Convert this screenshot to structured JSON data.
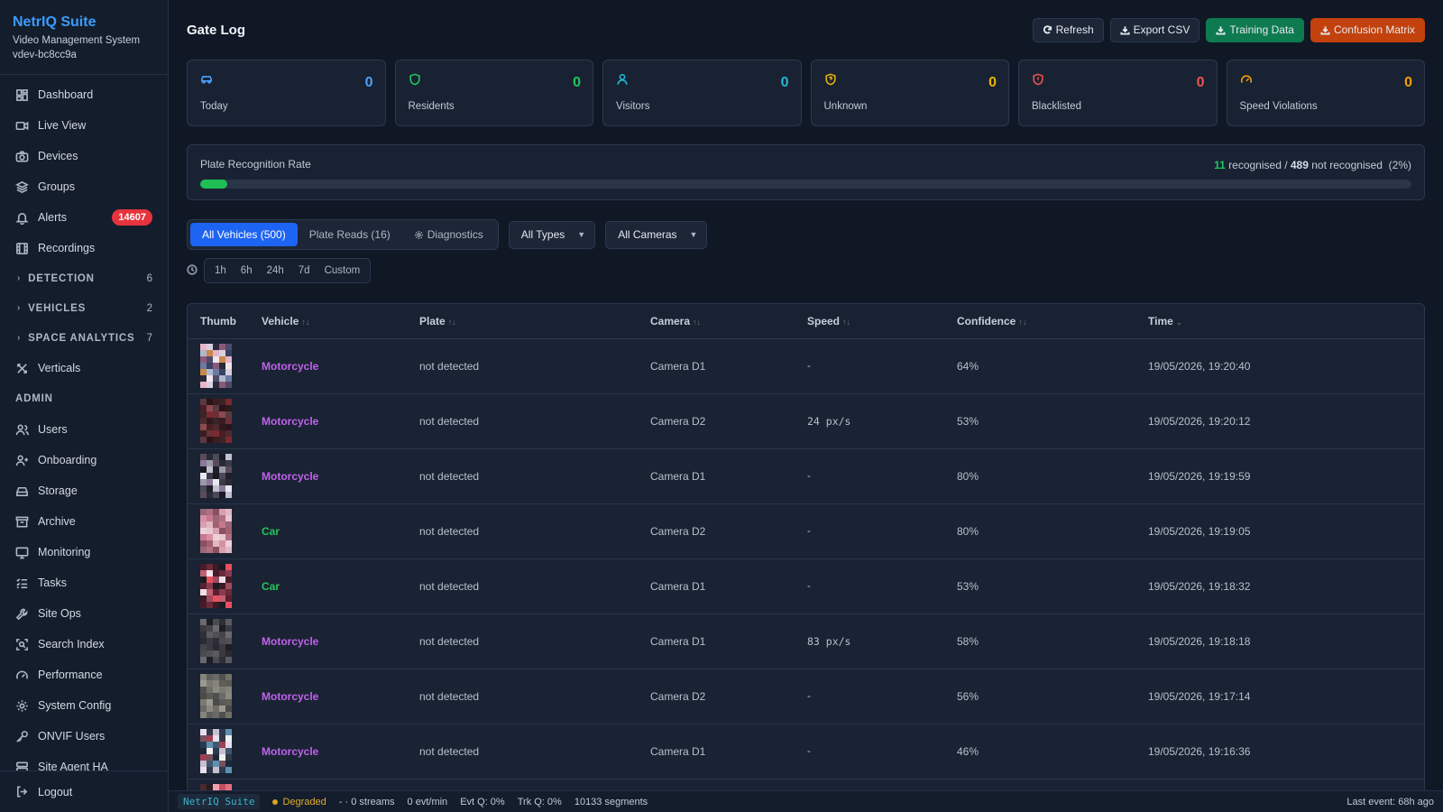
{
  "brand": {
    "title": "NetrIQ Suite",
    "subtitle": "Video Management System",
    "version": "vdev-bc8cc9a"
  },
  "sidebar": {
    "items": [
      {
        "label": "Dashboard",
        "icon": "dashboard-icon"
      },
      {
        "label": "Live View",
        "icon": "video-icon"
      },
      {
        "label": "Devices",
        "icon": "camera-icon"
      },
      {
        "label": "Groups",
        "icon": "layers-icon"
      },
      {
        "label": "Alerts",
        "icon": "bell-icon",
        "badge": "14607"
      },
      {
        "label": "Recordings",
        "icon": "film-icon"
      }
    ],
    "sections": [
      {
        "label": "DETECTION",
        "count": "6"
      },
      {
        "label": "VEHICLES",
        "count": "2"
      },
      {
        "label": "SPACE ANALYTICS",
        "count": "7"
      }
    ],
    "verticals": "Verticals",
    "admin_label": "ADMIN",
    "admin_items": [
      {
        "label": "Users",
        "icon": "users-icon"
      },
      {
        "label": "Onboarding",
        "icon": "user-plus-icon"
      },
      {
        "label": "Storage",
        "icon": "storage-icon"
      },
      {
        "label": "Archive",
        "icon": "archive-icon"
      },
      {
        "label": "Monitoring",
        "icon": "monitor-icon"
      },
      {
        "label": "Tasks",
        "icon": "tasks-icon"
      },
      {
        "label": "Site Ops",
        "icon": "wrench-icon"
      },
      {
        "label": "Search Index",
        "icon": "scan-icon"
      },
      {
        "label": "Performance",
        "icon": "gauge-icon"
      },
      {
        "label": "System Config",
        "icon": "gear-icon"
      },
      {
        "label": "ONVIF Users",
        "icon": "key-icon"
      },
      {
        "label": "Site Agent HA",
        "icon": "server-icon"
      }
    ],
    "logout": "Logout"
  },
  "header": {
    "title": "Gate Log",
    "buttons": {
      "refresh": "Refresh",
      "export": "Export CSV",
      "training": "Training Data",
      "confusion": "Confusion Matrix"
    }
  },
  "stats": [
    {
      "label": "Today",
      "value": "0",
      "color": "#4aa3ff",
      "icon": "car-icon"
    },
    {
      "label": "Residents",
      "value": "0",
      "color": "#22c55e",
      "icon": "shield-icon"
    },
    {
      "label": "Visitors",
      "value": "0",
      "color": "#22b8d6",
      "icon": "user-icon"
    },
    {
      "label": "Unknown",
      "value": "0",
      "color": "#eab308",
      "icon": "shield-question-icon"
    },
    {
      "label": "Blacklisted",
      "value": "0",
      "color": "#f05252",
      "icon": "shield-alert-icon"
    },
    {
      "label": "Speed Violations",
      "value": "0",
      "color": "#f59e0b",
      "icon": "gauge-icon"
    }
  ],
  "rate": {
    "label": "Plate Recognition Rate",
    "recognised": "11",
    "recognised_text": "recognised /",
    "not_recognised": "489",
    "not_recognised_text": "not recognised",
    "percent_text": "(2%)",
    "fill_fraction": 0.022
  },
  "filters": {
    "tabs": [
      "All Vehicles (500)",
      "Plate Reads (16)",
      "Diagnostics"
    ],
    "type_select": "All Types",
    "camera_select": "All Cameras",
    "time_ranges": [
      "1h",
      "6h",
      "24h",
      "7d",
      "Custom"
    ]
  },
  "table": {
    "columns": [
      "Thumb",
      "Vehicle",
      "Plate",
      "Camera",
      "Speed",
      "Confidence",
      "Time"
    ],
    "rows": [
      {
        "vehicle": "Motorcycle",
        "plate": "not detected",
        "camera": "Camera D1",
        "speed": "-",
        "confidence": "64%",
        "time": "19/05/2026, 19:20:40"
      },
      {
        "vehicle": "Motorcycle",
        "plate": "not detected",
        "camera": "Camera D2",
        "speed": "24 px/s",
        "confidence": "53%",
        "time": "19/05/2026, 19:20:12"
      },
      {
        "vehicle": "Motorcycle",
        "plate": "not detected",
        "camera": "Camera D1",
        "speed": "-",
        "confidence": "80%",
        "time": "19/05/2026, 19:19:59"
      },
      {
        "vehicle": "Car",
        "plate": "not detected",
        "camera": "Camera D2",
        "speed": "-",
        "confidence": "80%",
        "time": "19/05/2026, 19:19:05"
      },
      {
        "vehicle": "Car",
        "plate": "not detected",
        "camera": "Camera D1",
        "speed": "-",
        "confidence": "53%",
        "time": "19/05/2026, 19:18:32"
      },
      {
        "vehicle": "Motorcycle",
        "plate": "not detected",
        "camera": "Camera D1",
        "speed": "83 px/s",
        "confidence": "58%",
        "time": "19/05/2026, 19:18:18"
      },
      {
        "vehicle": "Motorcycle",
        "plate": "not detected",
        "camera": "Camera D2",
        "speed": "-",
        "confidence": "56%",
        "time": "19/05/2026, 19:17:14"
      },
      {
        "vehicle": "Motorcycle",
        "plate": "not detected",
        "camera": "Camera D1",
        "speed": "-",
        "confidence": "46%",
        "time": "19/05/2026, 19:16:36"
      },
      {
        "vehicle": "",
        "plate": "",
        "camera": "",
        "speed": "",
        "confidence": "",
        "time": ""
      }
    ],
    "vehicle_colors": {
      "Motorcycle": "#c062ec",
      "Car": "#22c55e"
    }
  },
  "statusbar": {
    "brand": "NetrIQ Suite",
    "status": "Degraded",
    "streams": "- · 0 streams",
    "evt": "0 evt/min",
    "evtq": "Evt Q: 0%",
    "trkq": "Trk Q: 0%",
    "segments": "10133 segments",
    "last_event": "Last event: 68h ago"
  }
}
